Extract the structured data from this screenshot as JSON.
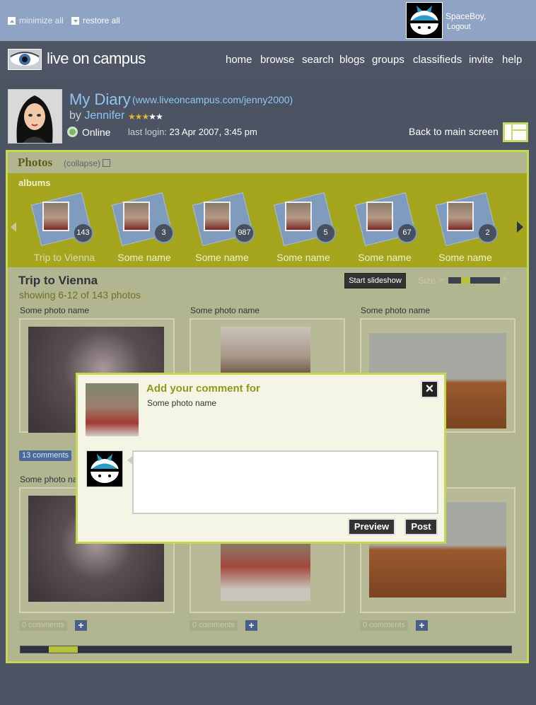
{
  "topbar": {
    "minimize_all": "minimize all",
    "restore_all": "restore all",
    "user_name": "SpaceBoy,",
    "logout": "Logout"
  },
  "header": {
    "logo_text": "live on campus",
    "nav": [
      "home",
      "browse",
      "search",
      "blogs",
      "groups",
      "classifieds",
      "invite",
      "help"
    ]
  },
  "profile": {
    "title": "My Diary",
    "url": "(www.liveoncampus.com/jenny2000)",
    "by": "by",
    "author": "Jennifer",
    "rating": 3,
    "rating_max": 5,
    "status": "Online",
    "last_login_label": "last login:",
    "last_login_value": "23 Apr 2007, 3:45 pm",
    "back_link": "Back to main screen"
  },
  "photos": {
    "title": "Photos",
    "collapse": "(collapse)",
    "albums_label": "albums",
    "albums": [
      {
        "name": "Trip to Vienna",
        "count": "143"
      },
      {
        "name": "Some name",
        "count": "3"
      },
      {
        "name": "Some name",
        "count": "987"
      },
      {
        "name": "Some name",
        "count": "5"
      },
      {
        "name": "Some name",
        "count": "67"
      },
      {
        "name": "Some name",
        "count": "2"
      }
    ],
    "album_title": "Trip to Vienna",
    "showing": "showing 6-12 of 143 photos",
    "slideshow": "Start slideshow",
    "size_label": "Size",
    "size_minus": "−",
    "size_plus": "+",
    "photo_name": "Some photo name",
    "comments_13": "13 comments",
    "comments_0": "0 comments"
  },
  "modal": {
    "title": "Add your comment for",
    "subtitle": "Some photo name",
    "preview": "Preview",
    "post": "Post",
    "close": "×"
  },
  "colors": {
    "accent": "#c5d84f",
    "topbar": "#8fa3c5",
    "link": "#8ec6f5"
  }
}
